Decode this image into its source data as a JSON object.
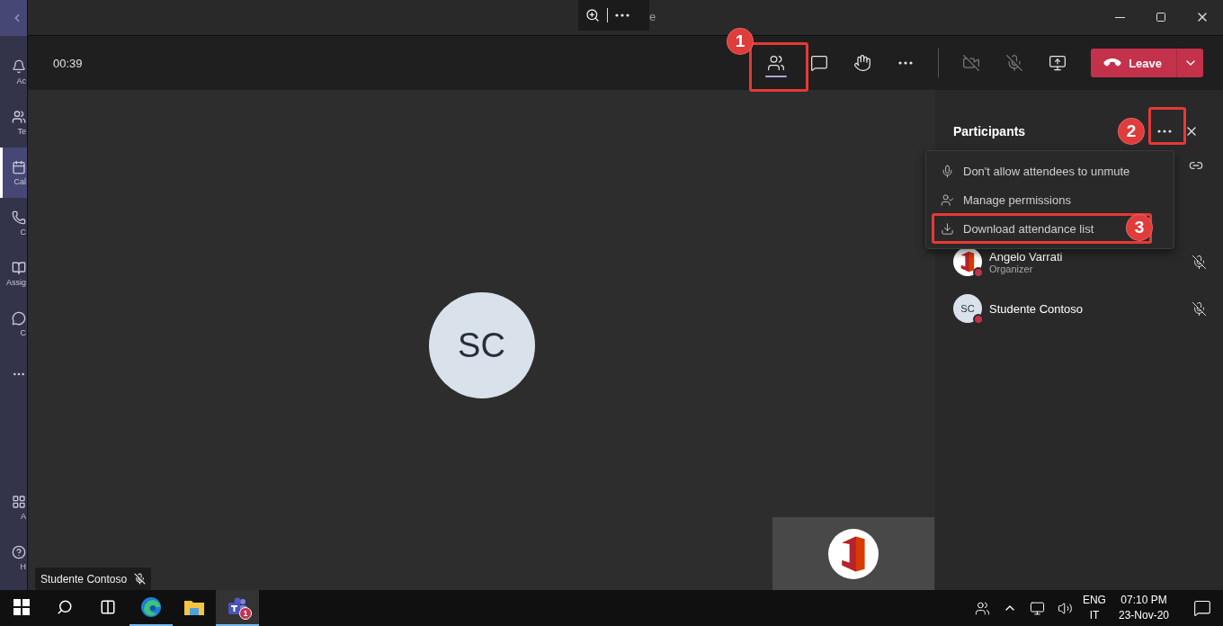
{
  "sidebar": {
    "items": [
      {
        "kind": "activity",
        "label": "Ac",
        "selected": false
      },
      {
        "kind": "teams",
        "label": "Te",
        "selected": false
      },
      {
        "kind": "calendar",
        "label": "Cal",
        "selected": true
      },
      {
        "kind": "calls",
        "label": "C",
        "selected": false
      },
      {
        "kind": "assignments",
        "label": "Assig",
        "selected": false
      },
      {
        "kind": "chat",
        "label": "C",
        "selected": false
      },
      {
        "kind": "more",
        "selected": false
      }
    ],
    "bottom_items": [
      {
        "kind": "apps",
        "label": "A",
        "selected": false
      },
      {
        "kind": "help",
        "label": "H",
        "selected": false
      }
    ]
  },
  "window": {
    "title": "e"
  },
  "call": {
    "timer": "00:39",
    "toolbar": [
      {
        "kind": "participants",
        "selected": true,
        "annotation": "1"
      },
      {
        "kind": "chat",
        "selected": false
      },
      {
        "kind": "hand",
        "selected": false
      },
      {
        "kind": "more",
        "selected": false
      },
      {
        "kind": "divider"
      },
      {
        "kind": "camera-off",
        "selected": false
      },
      {
        "kind": "mic-off",
        "selected": false
      },
      {
        "kind": "share",
        "selected": false
      }
    ],
    "leave": "Leave"
  },
  "stage": {
    "initials": "SC",
    "name_tag": "Studente Contoso",
    "self_view": {
      "kind": "logo"
    }
  },
  "participants": {
    "title": "Participants",
    "more_annotation": "2",
    "menu": [
      {
        "kind": "mic",
        "label": "Don't allow attendees to unmute"
      },
      {
        "kind": "permissions",
        "label": "Manage permissions"
      },
      {
        "kind": "download",
        "label": "Download attendance list",
        "annotation": "3"
      }
    ],
    "people": [
      {
        "name": "Angelo Varrati",
        "role": "Organizer",
        "kind": "logo"
      },
      {
        "name": "Studente Contoso",
        "kind": "initials",
        "initials": "SC"
      }
    ]
  },
  "taskbar": {
    "apps": [
      {
        "kind": "start",
        "selected": false
      },
      {
        "kind": "search",
        "selected": false
      },
      {
        "kind": "task-view",
        "selected": false
      },
      {
        "kind": "edge",
        "selected": false,
        "running": true
      },
      {
        "kind": "explorer",
        "selected": false,
        "running": false
      },
      {
        "kind": "teams",
        "selected": true,
        "running": true,
        "badge": "1"
      }
    ],
    "language": "ENG",
    "region": "IT",
    "time": "07:10 PM",
    "date": "23-Nov-20"
  }
}
